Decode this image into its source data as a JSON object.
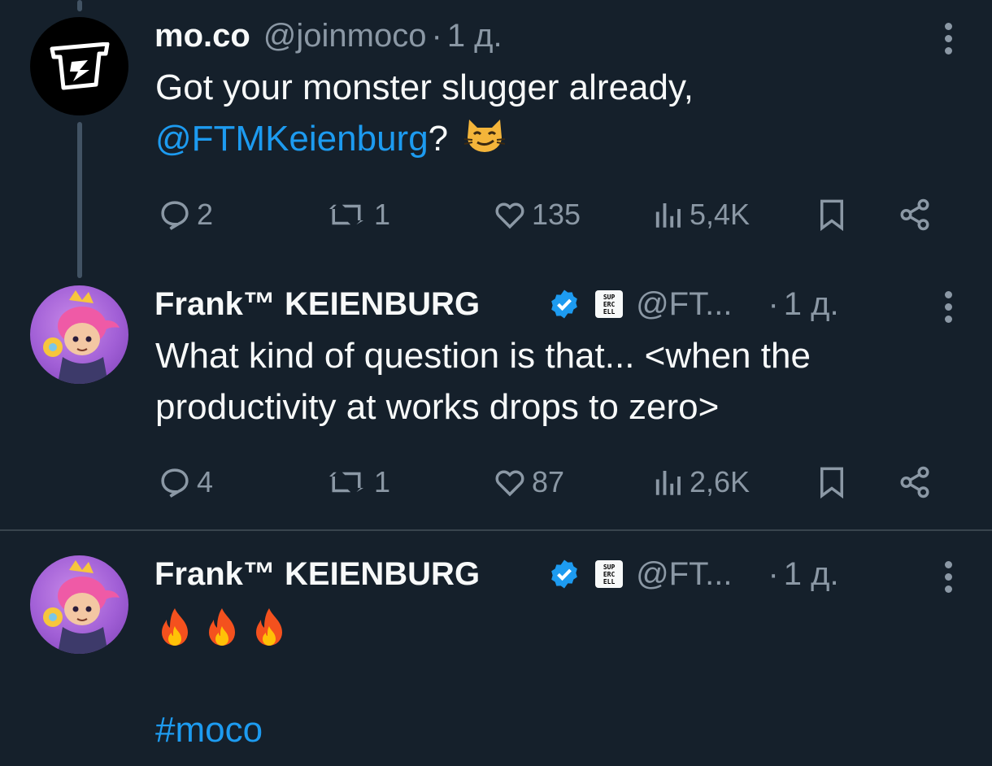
{
  "tweets": [
    {
      "name": "mo.co",
      "handle": "@joinmoco",
      "dot": "·",
      "time": "1 д.",
      "text_line1": "Got your monster slugger already,",
      "mention": "@FTMKeienburg",
      "text_after_mention": "?",
      "emoji": "smirking-cat-emoji",
      "replies": "2",
      "retweets": "1",
      "likes": "135",
      "views": "5,4K"
    },
    {
      "name": "Frank™ KEIENBURG",
      "handle": "@FT...",
      "dot": "·",
      "time": "1 д.",
      "text_line1": "What kind of question is that... <when the",
      "text_line2": "productivity at works drops to zero>",
      "replies": "4",
      "retweets": "1",
      "likes": "87",
      "views": "2,6K"
    },
    {
      "name": "Frank™ KEIENBURG",
      "handle": "@FT...",
      "dot": "·",
      "time": "1 д.",
      "emojis": [
        "fire-emoji",
        "fire-emoji",
        "fire-emoji"
      ],
      "hashtag": "#moco"
    }
  ],
  "colors": {
    "background": "#15202b",
    "text": "#f7f9f9",
    "muted": "#8b98a5",
    "link": "#1d9bf0",
    "verified": "#1d9bf0"
  }
}
